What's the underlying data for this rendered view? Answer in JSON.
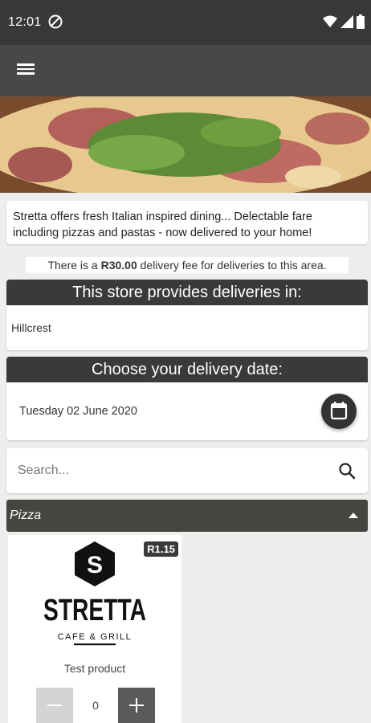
{
  "status_bar": {
    "time": "12:01"
  },
  "header": {
    "menu_icon": "hamburger-menu-icon"
  },
  "store": {
    "description": "Stretta offers fresh Italian inspired dining... Delectable fare including pizzas and pastas - now delivered to your home!",
    "fee_prefix": "There is a ",
    "fee_amount": "R30.00",
    "fee_suffix": " delivery fee for deliveries to this area."
  },
  "delivery_areas": {
    "heading": "This store provides deliveries in:",
    "areas": "Hillcrest"
  },
  "delivery_date": {
    "heading": "Choose your delivery date:",
    "value": "Tuesday 02 June 2020",
    "icon": "calendar-icon"
  },
  "search": {
    "placeholder": "Search...",
    "value": "",
    "icon": "search-icon"
  },
  "category": {
    "label": "Pizza",
    "icon": "collapse-arrow-icon"
  },
  "products": [
    {
      "name": "Test product",
      "price": "R1.15",
      "logo_letter": "S",
      "logo_title": "STRETTA",
      "logo_subtitle": "CAFE & GRILL",
      "quantity": "0"
    }
  ],
  "colors": {
    "status_bar": "#383838",
    "app_bar": "#484848",
    "section_header": "#3a3a3a",
    "category_bar": "#474540"
  }
}
